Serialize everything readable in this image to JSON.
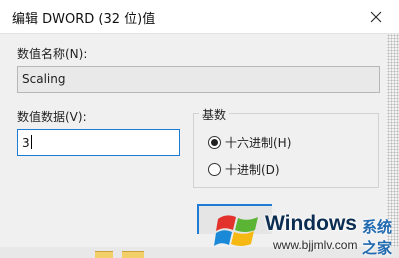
{
  "dialog": {
    "title": "编辑 DWORD (32 位)值"
  },
  "value_name": {
    "label": "数值名称(N):",
    "value": "Scaling"
  },
  "value_data": {
    "label": "数值数据(V):",
    "value": "3"
  },
  "base": {
    "title": "基数",
    "options": [
      {
        "label": "十六进制(H)",
        "selected": true
      },
      {
        "label": "十进制(D)",
        "selected": false
      }
    ]
  },
  "watermark": {
    "brand": "Windows",
    "brand_cn": "系统之家",
    "url": "www.bjjmlv.com"
  },
  "colors": {
    "focus_border": "#1e7bd6",
    "logo_blue": "#1a8ad8",
    "logo_red": "#e2322b",
    "logo_green": "#5bb434",
    "logo_yellow": "#f6b913"
  }
}
